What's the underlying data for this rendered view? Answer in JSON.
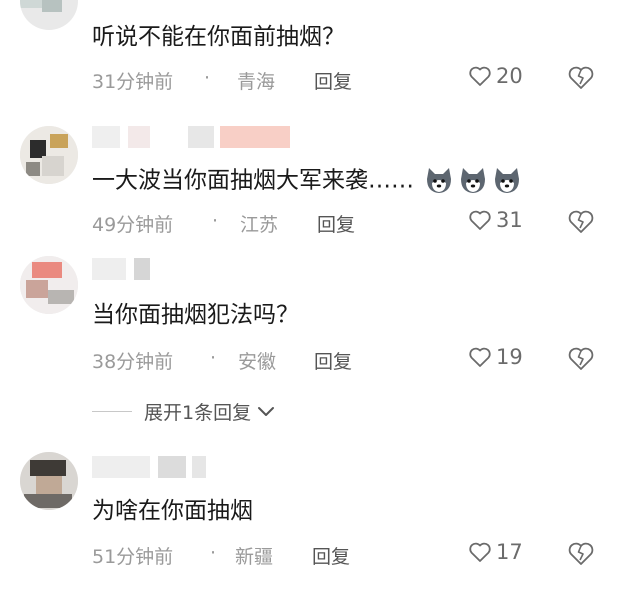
{
  "comments": [
    {
      "text": "听说不能在你面前抽烟？",
      "time": "31分钟前",
      "dot": "·",
      "location": "青海",
      "reply_label": "回复",
      "likes": "20"
    },
    {
      "text": "一大波当你面抽烟大军来袭……",
      "emoji_count": 3,
      "emoji_icon": "husky-dog-emoji",
      "time": "49分钟前",
      "dot": "·",
      "location": "江苏",
      "reply_label": "回复",
      "likes": "31"
    },
    {
      "text": "当你面抽烟犯法吗？",
      "time": "38分钟前",
      "dot": "·",
      "location": "安徽",
      "reply_label": "回复",
      "likes": "19"
    },
    {
      "text": "为啥在你面抽烟",
      "time": "51分钟前",
      "dot": "·",
      "location": "新疆",
      "reply_label": "回复",
      "likes": "17"
    }
  ],
  "expand_replies": {
    "label": "展开1条回复"
  },
  "icons": {
    "like": "heart-outline-icon",
    "dislike": "broken-heart-icon",
    "chevron": "chevron-down-icon"
  },
  "colors": {
    "text": "#1a1a1a",
    "meta": "#9a9a9a",
    "reply": "#555555"
  }
}
